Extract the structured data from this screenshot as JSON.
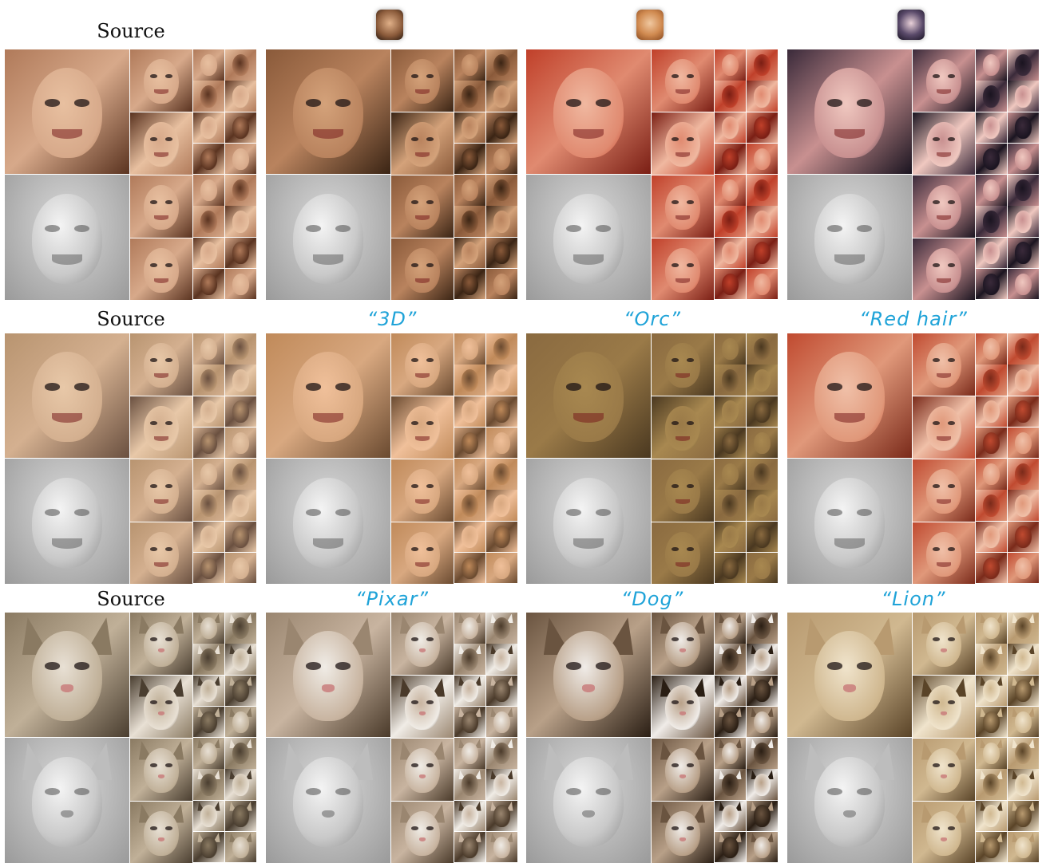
{
  "labels": {
    "row1_source": "Source",
    "row2_source": "Source",
    "row3_source": "Source",
    "p_3d": "“3D”",
    "p_orc": "“Orc”",
    "p_red_hair": "“Red hair”",
    "p_pixar": "“Pixar”",
    "p_dog": "“Dog”",
    "p_lion": "“Lion”"
  },
  "colors": {
    "prompt_text": "#1fa3d8",
    "caption_text": "#111111",
    "background": "#ffffff"
  },
  "rows": [
    {
      "subject": "human-face",
      "columns": [
        {
          "palette": [
            "#b07a5a",
            "#e8c0a0",
            "#5a3320",
            "#d7a98a"
          ]
        },
        {
          "palette": [
            "#8a5a3a",
            "#d4a27a",
            "#3a2414",
            "#b9835e"
          ]
        },
        {
          "palette": [
            "#c0402a",
            "#f0b8a0",
            "#7a1e14",
            "#e08a70"
          ]
        },
        {
          "palette": [
            "#3a2a3a",
            "#f0c8c0",
            "#1a1420",
            "#c89090"
          ]
        }
      ]
    },
    {
      "subject": "human-face",
      "columns": [
        {
          "palette": [
            "#b89470",
            "#e8c8a8",
            "#6a5040",
            "#d4b090"
          ]
        },
        {
          "palette": [
            "#c08a5a",
            "#f0c09a",
            "#6a4a30",
            "#d8a880"
          ]
        },
        {
          "palette": [
            "#8a6a40",
            "#a88850",
            "#4a3820",
            "#9a7a48"
          ]
        },
        {
          "palette": [
            "#c04a30",
            "#f0c0a8",
            "#7a2a1a",
            "#e0987a"
          ]
        }
      ]
    },
    {
      "subject": "cat-face",
      "columns": [
        {
          "palette": [
            "#8a7a62",
            "#e8e0d4",
            "#4a3e30",
            "#c0b098"
          ]
        },
        {
          "palette": [
            "#9a8670",
            "#f0ece6",
            "#4a3a2a",
            "#c8b4a0"
          ]
        },
        {
          "palette": [
            "#6a5440",
            "#f0ece8",
            "#2a1e14",
            "#b8a088"
          ]
        },
        {
          "palette": [
            "#b89a70",
            "#f0e4cc",
            "#5a4428",
            "#d0b890"
          ]
        }
      ]
    }
  ]
}
